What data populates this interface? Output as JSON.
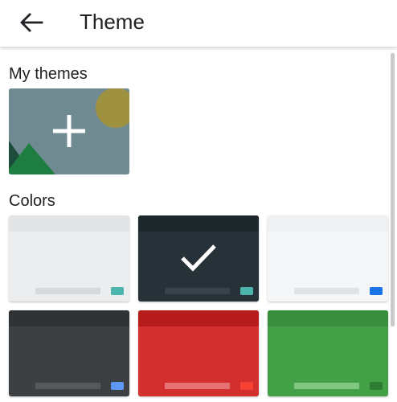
{
  "header": {
    "title": "Theme",
    "back_icon": "arrow-back-icon"
  },
  "sections": {
    "my_themes": "My themes",
    "colors": "Colors"
  },
  "add_tile": {
    "icon": "plus-icon"
  },
  "colors": {
    "light_gray": {
      "body": "#ebedef",
      "bar": "#e2e4e6",
      "key": "#d6d8da",
      "accent": "#4db6ac"
    },
    "dark": {
      "body": "#263238",
      "bar": "#1d282d",
      "key": "#36434a",
      "accent": "#4db6ac",
      "selected": true
    },
    "white": {
      "body": "#f5f6f7",
      "bar": "#eef0f1",
      "key": "#e0e2e3",
      "accent": "#1a73e8"
    },
    "dark_gray": {
      "body": "#3c4043",
      "bar": "#2f3336",
      "key": "#55595d",
      "accent": "#5e97f6"
    },
    "red": {
      "body": "#d32f2f",
      "bar": "#b71c1c",
      "key": "#e57373",
      "accent": "#f44336"
    },
    "green": {
      "body": "#43a047",
      "bar": "#388e3c",
      "key": "#81c784",
      "accent": "#2e7d32"
    }
  }
}
